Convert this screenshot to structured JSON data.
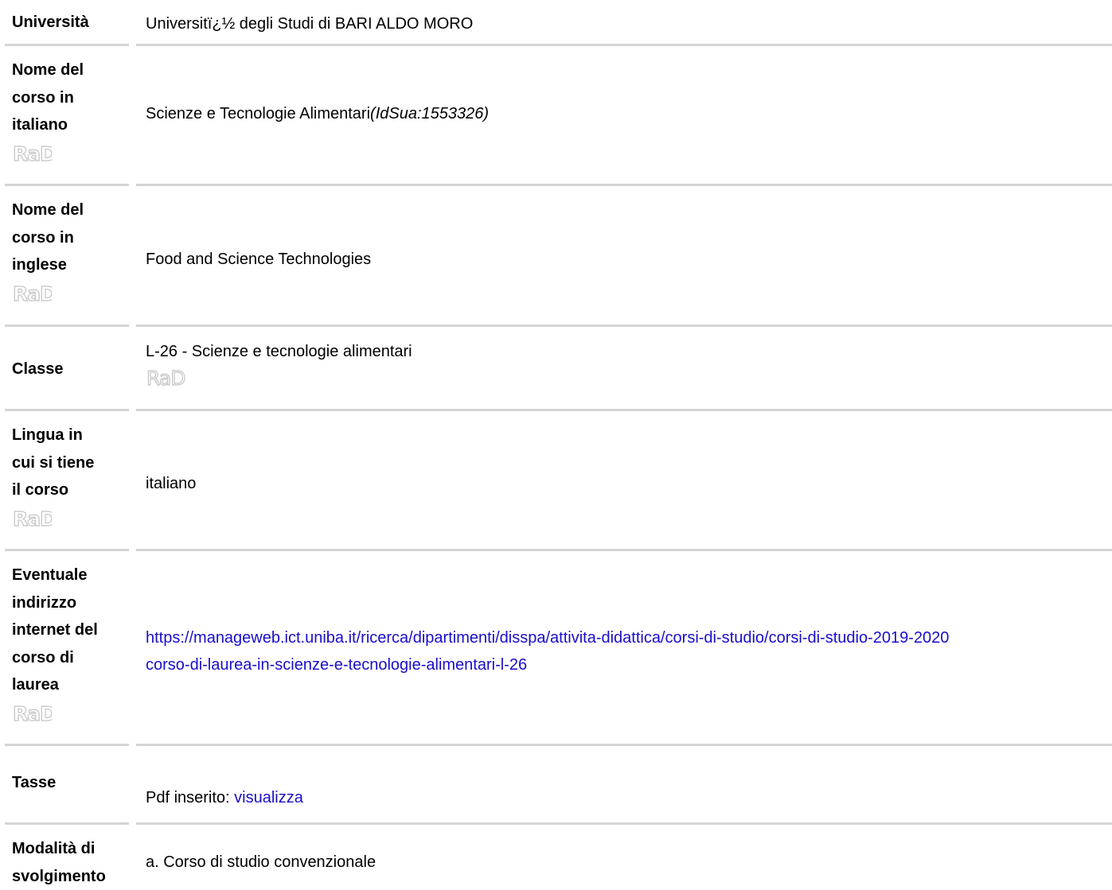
{
  "rows": {
    "universita": {
      "label": "Università",
      "value": "Universitï¿½ degli Studi di BARI ALDO MORO"
    },
    "nome_italiano": {
      "label_lines": [
        "Nome del",
        "corso in",
        "italiano"
      ],
      "value": "Scienze e Tecnologie Alimentari",
      "id_sua": "(IdSua:1553326)"
    },
    "nome_inglese": {
      "label_lines": [
        "Nome del",
        "corso in",
        "inglese"
      ],
      "value": "Food and Science Technologies"
    },
    "classe": {
      "label": "Classe",
      "value": "L-26 - Scienze e tecnologie alimentari"
    },
    "lingua": {
      "label_lines": [
        "Lingua in",
        "cui si tiene",
        "il corso"
      ],
      "value": "italiano"
    },
    "indirizzo": {
      "label_lines": [
        "Eventuale",
        "indirizzo",
        "internet del",
        "corso di",
        "laurea"
      ],
      "link_line1": "https://manageweb.ict.uniba.it/ricerca/dipartimenti/disspa/attivita-didattica/corsi-di-studio/corsi-di-studio-2019-2020",
      "link_line2": "corso-di-laurea-in-scienze-e-tecnologie-alimentari-l-26"
    },
    "tasse": {
      "label": "Tasse",
      "prefix": "Pdf inserito: ",
      "link": "visualizza"
    },
    "modalita": {
      "label_lines": [
        "Modalità di",
        "svolgimento"
      ],
      "value": "a. Corso di studio convenzionale"
    }
  },
  "rad_badge": "RaD",
  "separator_color": "#d4d4d4",
  "link_color": "#1a0dcc"
}
